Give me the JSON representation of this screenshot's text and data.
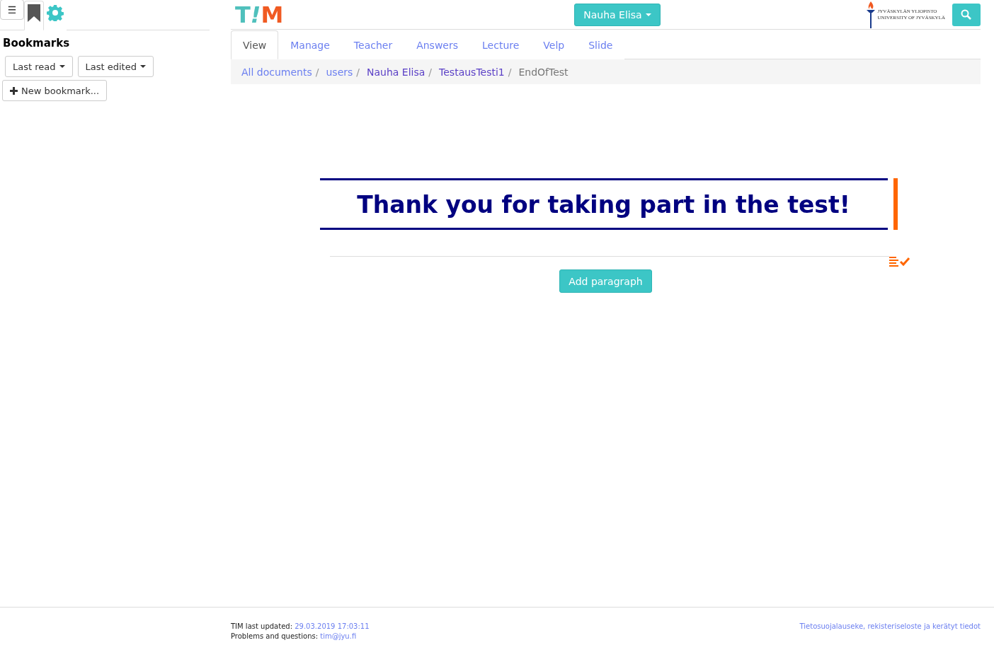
{
  "sidebar": {
    "tabs": [
      {
        "kind": "menu",
        "label": "☰",
        "selected": false
      },
      {
        "kind": "bookmark",
        "selected": true
      },
      {
        "kind": "settings",
        "selected": false
      }
    ],
    "title": "Bookmarks",
    "sort_buttons": [
      "Last read",
      "Last edited"
    ],
    "new_bookmark": "New bookmark..."
  },
  "header": {
    "logo_parts": [
      "T",
      "!",
      "M"
    ],
    "user_button": "Nauha Elisa",
    "university": [
      "JYVÄSKYLÄN YLIOPISTO",
      "UNIVERSITY OF JYVÄSKYLÄ"
    ]
  },
  "tabs": [
    {
      "label": "View",
      "selected": true
    },
    {
      "label": "Manage",
      "selected": false
    },
    {
      "label": "Teacher",
      "selected": false
    },
    {
      "label": "Answers",
      "selected": false
    },
    {
      "label": "Lecture",
      "selected": false
    },
    {
      "label": "Velp",
      "selected": false
    },
    {
      "label": "Slide",
      "selected": false
    }
  ],
  "breadcrumb": [
    {
      "label": "All documents",
      "visited": false,
      "current": false,
      "separator": "/"
    },
    {
      "label": "users",
      "visited": false,
      "current": false,
      "separator": "/"
    },
    {
      "label": "Nauha Elisa",
      "visited": true,
      "current": false,
      "separator": "/"
    },
    {
      "label": "TestausTesti1",
      "visited": true,
      "current": false,
      "separator": "/"
    },
    {
      "label": "EndOfTest",
      "visited": false,
      "current": true
    }
  ],
  "document": {
    "heading": "Thank you for taking part in the test!",
    "changed": true,
    "add_button": "Add paragraph"
  },
  "footer": {
    "updated_label": "TIM last updated:",
    "updated_value": "29.03.2019 17:03:11",
    "contact_label": "Problems and questions:",
    "contact_value": "tim@jyu.fi",
    "privacy_link": "Tietosuojalauseke, rekisteriseloste ja kerätyt tiedot"
  }
}
